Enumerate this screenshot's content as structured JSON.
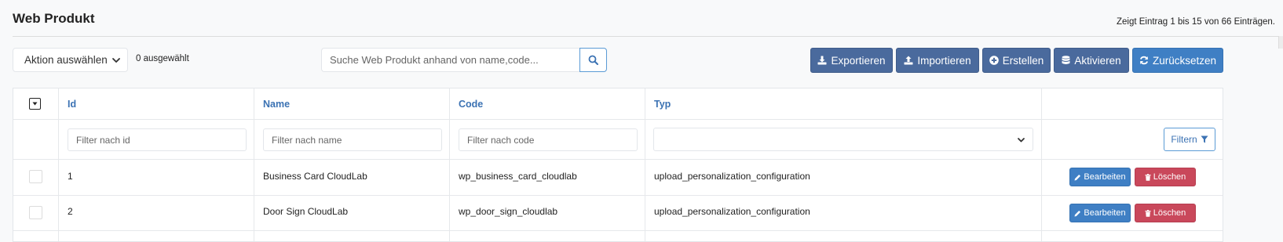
{
  "header": {
    "title": "Web Produkt",
    "entries_info": "Zeigt Eintrag 1 bis 15 von 66 Einträgen."
  },
  "toolbar": {
    "action_select": {
      "value": "Aktion auswählen",
      "options": [
        "Aktion auswählen"
      ]
    },
    "selected_count": "0 ausgewählt",
    "search": {
      "placeholder": "Suche Web Produkt anhand von name,code...",
      "value": ""
    },
    "buttons": {
      "export": "Exportieren",
      "import": "Importieren",
      "create": "Erstellen",
      "activate": "Aktivieren",
      "reset": "Zurücksetzen"
    },
    "icons": {
      "export": "download-icon",
      "import": "upload-icon",
      "create": "plus-circle-icon",
      "activate": "database-icon",
      "reset": "refresh-icon",
      "search": "search-icon"
    }
  },
  "table": {
    "columns": {
      "id": "Id",
      "name": "Name",
      "code": "Code",
      "type": "Typ"
    },
    "filters": {
      "id_placeholder": "Filter nach id",
      "name_placeholder": "Filter nach name",
      "code_placeholder": "Filter nach code",
      "type_value": "",
      "filter_button": "Filtern"
    },
    "rows": [
      {
        "id": "1",
        "name": "Business Card CloudLab",
        "code": "wp_business_card_cloudlab",
        "type": "upload_personalization_configuration",
        "edit": "Bearbeiten",
        "delete": "Löschen"
      },
      {
        "id": "2",
        "name": "Door Sign CloudLab",
        "code": "wp_door_sign_cloudlab",
        "type": "upload_personalization_configuration",
        "edit": "Bearbeiten",
        "delete": "Löschen"
      }
    ]
  },
  "colors": {
    "navy_button": "#4a6a9d",
    "blue_button": "#3f7fc4",
    "danger_button": "#c9485b",
    "header_link": "#3b72b3"
  }
}
